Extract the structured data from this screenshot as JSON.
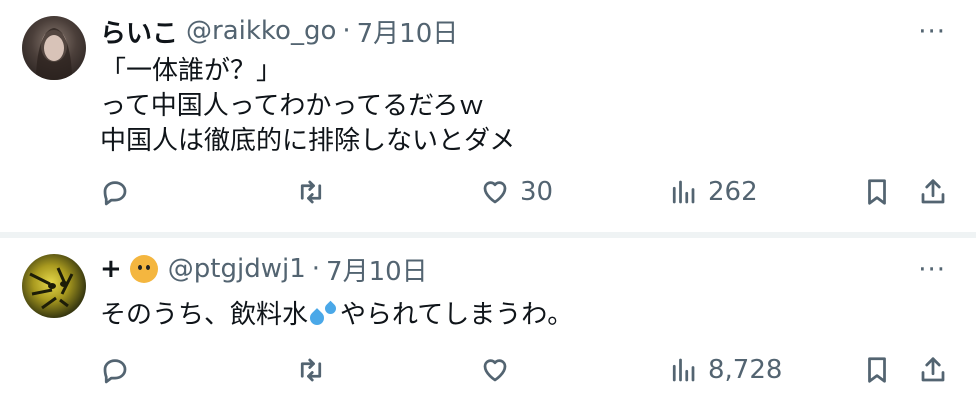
{
  "tweets": [
    {
      "name": "らいこ",
      "handle": "@raikko_go",
      "separator": "·",
      "date": "7月10日",
      "more": "···",
      "lines": [
        "「一体誰が？」",
        "って中国人ってわかってるだろｗ",
        "中国人は徹底的に排除しないとダメ"
      ],
      "likes": "30",
      "views": "262"
    },
    {
      "name": "+",
      "name_emoji": "tiger-face",
      "handle": "@ptgjdwj1",
      "separator": "·",
      "date": "7月10日",
      "more": "···",
      "text_before": "そのうち、飲料水",
      "text_emoji": "sweat-droplets",
      "text_after": "やられてしまうわ。",
      "likes": "",
      "views": "8,728"
    }
  ],
  "icons": [
    "reply-icon",
    "retweet-icon",
    "like-icon",
    "views-icon",
    "bookmark-icon",
    "share-icon",
    "more-icon"
  ],
  "colors": {
    "text": "#0f1419",
    "muted": "#536471",
    "divider": "#eff3f4"
  }
}
